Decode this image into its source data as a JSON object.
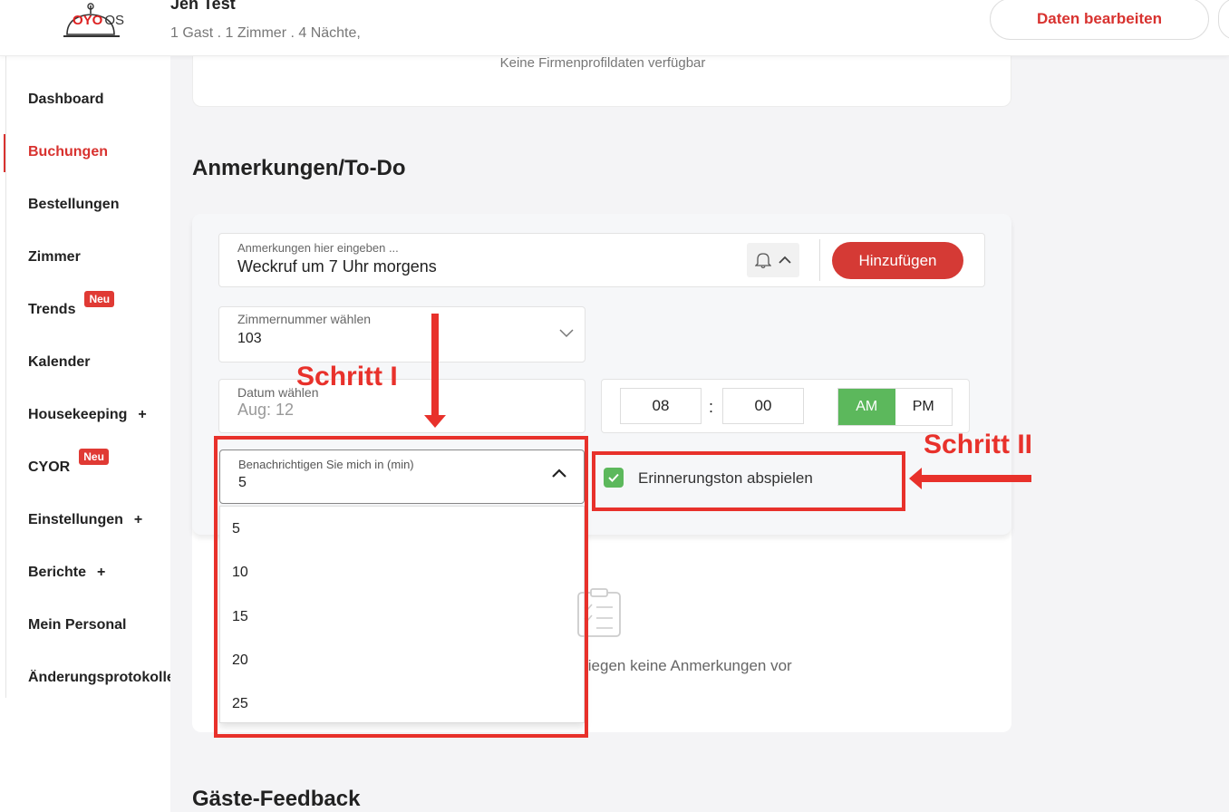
{
  "header": {
    "brand_oyo": "OYO",
    "brand_os": "OS",
    "guest_name": "Jen Test",
    "guest_summary": "1 Gast . 1 Zimmer . 4 Nächte,",
    "edit_button": "Daten bearbeiten"
  },
  "sidebar": {
    "items": [
      {
        "label": "Dashboard"
      },
      {
        "label": "Buchungen",
        "active": true
      },
      {
        "label": "Bestellungen"
      },
      {
        "label": "Zimmer"
      },
      {
        "label": "Trends",
        "badge": "Neu"
      },
      {
        "label": "Kalender"
      },
      {
        "label": "Housekeeping",
        "expand": "+"
      },
      {
        "label": "CYOR",
        "badge": "Neu"
      },
      {
        "label": "Einstellungen",
        "expand": "+"
      },
      {
        "label": "Berichte",
        "expand": "+"
      },
      {
        "label": "Mein Personal"
      },
      {
        "label": "Änderungsprotokolle"
      }
    ]
  },
  "company_card": {
    "empty_text": "Keine Firmenprofildaten verfügbar"
  },
  "notes": {
    "section_title": "Anmerkungen/To-Do",
    "input_label": "Anmerkungen hier eingeben ...",
    "input_value": "Weckruf um 7 Uhr morgens",
    "add_button": "Hinzufügen",
    "room_label": "Zimmernummer wählen",
    "room_value": "103",
    "date_label": "Datum wählen",
    "date_value": "Aug: 12",
    "hour": "08",
    "colon": ":",
    "minute": "00",
    "am": "AM",
    "pm": "PM",
    "notify_label": "Benachrichtigen Sie mich in (min)",
    "notify_value": "5",
    "notify_options": [
      "5",
      "10",
      "15",
      "20",
      "25"
    ],
    "sound_label": "Erinnerungston abspielen",
    "sound_checked": true,
    "empty_text": "liegen keine Anmerkungen vor"
  },
  "feedback": {
    "section_title": "Gäste-Feedback"
  },
  "annotations": {
    "step1": "Schritt I",
    "step2": "Schritt II"
  },
  "colors": {
    "accent": "#d8322f",
    "annotation_red": "#e8312b",
    "green": "#5cb85c"
  }
}
